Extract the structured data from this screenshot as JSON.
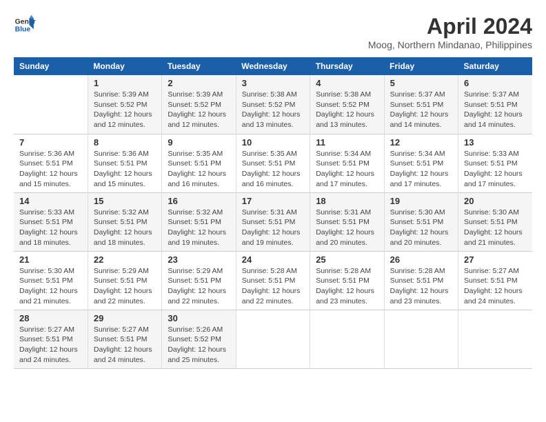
{
  "header": {
    "logo_line1": "General",
    "logo_line2": "Blue",
    "title": "April 2024",
    "location": "Moog, Northern Mindanao, Philippines"
  },
  "weekdays": [
    "Sunday",
    "Monday",
    "Tuesday",
    "Wednesday",
    "Thursday",
    "Friday",
    "Saturday"
  ],
  "weeks": [
    [
      {
        "day": "",
        "info": ""
      },
      {
        "day": "1",
        "info": "Sunrise: 5:39 AM\nSunset: 5:52 PM\nDaylight: 12 hours\nand 12 minutes."
      },
      {
        "day": "2",
        "info": "Sunrise: 5:39 AM\nSunset: 5:52 PM\nDaylight: 12 hours\nand 12 minutes."
      },
      {
        "day": "3",
        "info": "Sunrise: 5:38 AM\nSunset: 5:52 PM\nDaylight: 12 hours\nand 13 minutes."
      },
      {
        "day": "4",
        "info": "Sunrise: 5:38 AM\nSunset: 5:52 PM\nDaylight: 12 hours\nand 13 minutes."
      },
      {
        "day": "5",
        "info": "Sunrise: 5:37 AM\nSunset: 5:51 PM\nDaylight: 12 hours\nand 14 minutes."
      },
      {
        "day": "6",
        "info": "Sunrise: 5:37 AM\nSunset: 5:51 PM\nDaylight: 12 hours\nand 14 minutes."
      }
    ],
    [
      {
        "day": "7",
        "info": "Sunrise: 5:36 AM\nSunset: 5:51 PM\nDaylight: 12 hours\nand 15 minutes."
      },
      {
        "day": "8",
        "info": "Sunrise: 5:36 AM\nSunset: 5:51 PM\nDaylight: 12 hours\nand 15 minutes."
      },
      {
        "day": "9",
        "info": "Sunrise: 5:35 AM\nSunset: 5:51 PM\nDaylight: 12 hours\nand 16 minutes."
      },
      {
        "day": "10",
        "info": "Sunrise: 5:35 AM\nSunset: 5:51 PM\nDaylight: 12 hours\nand 16 minutes."
      },
      {
        "day": "11",
        "info": "Sunrise: 5:34 AM\nSunset: 5:51 PM\nDaylight: 12 hours\nand 17 minutes."
      },
      {
        "day": "12",
        "info": "Sunrise: 5:34 AM\nSunset: 5:51 PM\nDaylight: 12 hours\nand 17 minutes."
      },
      {
        "day": "13",
        "info": "Sunrise: 5:33 AM\nSunset: 5:51 PM\nDaylight: 12 hours\nand 17 minutes."
      }
    ],
    [
      {
        "day": "14",
        "info": "Sunrise: 5:33 AM\nSunset: 5:51 PM\nDaylight: 12 hours\nand 18 minutes."
      },
      {
        "day": "15",
        "info": "Sunrise: 5:32 AM\nSunset: 5:51 PM\nDaylight: 12 hours\nand 18 minutes."
      },
      {
        "day": "16",
        "info": "Sunrise: 5:32 AM\nSunset: 5:51 PM\nDaylight: 12 hours\nand 19 minutes."
      },
      {
        "day": "17",
        "info": "Sunrise: 5:31 AM\nSunset: 5:51 PM\nDaylight: 12 hours\nand 19 minutes."
      },
      {
        "day": "18",
        "info": "Sunrise: 5:31 AM\nSunset: 5:51 PM\nDaylight: 12 hours\nand 20 minutes."
      },
      {
        "day": "19",
        "info": "Sunrise: 5:30 AM\nSunset: 5:51 PM\nDaylight: 12 hours\nand 20 minutes."
      },
      {
        "day": "20",
        "info": "Sunrise: 5:30 AM\nSunset: 5:51 PM\nDaylight: 12 hours\nand 21 minutes."
      }
    ],
    [
      {
        "day": "21",
        "info": "Sunrise: 5:30 AM\nSunset: 5:51 PM\nDaylight: 12 hours\nand 21 minutes."
      },
      {
        "day": "22",
        "info": "Sunrise: 5:29 AM\nSunset: 5:51 PM\nDaylight: 12 hours\nand 22 minutes."
      },
      {
        "day": "23",
        "info": "Sunrise: 5:29 AM\nSunset: 5:51 PM\nDaylight: 12 hours\nand 22 minutes."
      },
      {
        "day": "24",
        "info": "Sunrise: 5:28 AM\nSunset: 5:51 PM\nDaylight: 12 hours\nand 22 minutes."
      },
      {
        "day": "25",
        "info": "Sunrise: 5:28 AM\nSunset: 5:51 PM\nDaylight: 12 hours\nand 23 minutes."
      },
      {
        "day": "26",
        "info": "Sunrise: 5:28 AM\nSunset: 5:51 PM\nDaylight: 12 hours\nand 23 minutes."
      },
      {
        "day": "27",
        "info": "Sunrise: 5:27 AM\nSunset: 5:51 PM\nDaylight: 12 hours\nand 24 minutes."
      }
    ],
    [
      {
        "day": "28",
        "info": "Sunrise: 5:27 AM\nSunset: 5:51 PM\nDaylight: 12 hours\nand 24 minutes."
      },
      {
        "day": "29",
        "info": "Sunrise: 5:27 AM\nSunset: 5:51 PM\nDaylight: 12 hours\nand 24 minutes."
      },
      {
        "day": "30",
        "info": "Sunrise: 5:26 AM\nSunset: 5:52 PM\nDaylight: 12 hours\nand 25 minutes."
      },
      {
        "day": "",
        "info": ""
      },
      {
        "day": "",
        "info": ""
      },
      {
        "day": "",
        "info": ""
      },
      {
        "day": "",
        "info": ""
      }
    ]
  ]
}
